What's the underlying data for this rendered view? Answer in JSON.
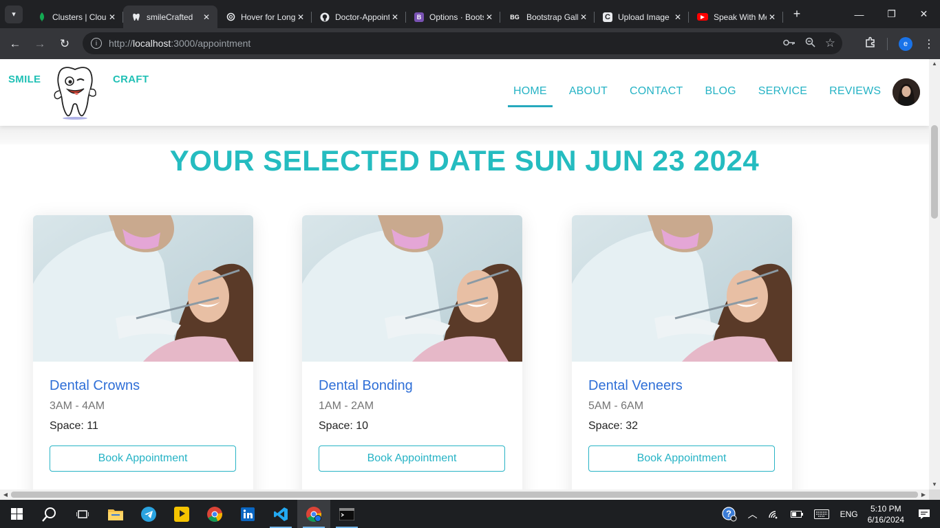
{
  "browser": {
    "tabs": [
      {
        "title": "Clusters | Cloud",
        "icon": "mongodb-leaf-icon",
        "color": "#13aa52"
      },
      {
        "title": "smileCrafted",
        "icon": "site-tooth-icon",
        "color": "#ffffff",
        "active": true
      },
      {
        "title": "Hover for Long",
        "icon": "openai-icon",
        "color": "#ffffff"
      },
      {
        "title": "Doctor-Appointment",
        "icon": "github-icon",
        "color": "#ffffff"
      },
      {
        "title": "Options · Bootstrap",
        "icon": "bootstrap-icon",
        "color": "#7952b3"
      },
      {
        "title": "Bootstrap Gallery",
        "icon": "bg-icon",
        "color": "#ffffff"
      },
      {
        "title": "Upload Image",
        "icon": "c-icon",
        "color": "#ffffff"
      },
      {
        "title": "Speak With Me",
        "icon": "youtube-icon",
        "color": "#ff0000"
      }
    ],
    "url_prefix": "http://",
    "url_host": "localhost",
    "url_rest": ":3000/appointment",
    "profile_letter": "e"
  },
  "site": {
    "logo_left": "SMILE",
    "logo_right": "CRAFT",
    "nav": [
      "HOME",
      "ABOUT",
      "CONTACT",
      "BLOG",
      "SERVICE",
      "REVIEWS"
    ],
    "nav_active": "HOME",
    "accent": "#26b3c5"
  },
  "page": {
    "heading": "YOUR SELECTED DATE SUN JUN 23 2024",
    "cards": [
      {
        "title": "Dental Crowns",
        "time": "3AM - 4AM",
        "space_label": "Space: 11",
        "button": "Book Appointment"
      },
      {
        "title": "Dental Bonding",
        "time": "1AM - 2AM",
        "space_label": "Space: 10",
        "button": "Book Appointment"
      },
      {
        "title": "Dental Veneers",
        "time": "5AM - 6AM",
        "space_label": "Space: 32",
        "button": "Book Appointment"
      }
    ]
  },
  "taskbar": {
    "language": "ENG",
    "time": "5:10 PM",
    "date": "6/16/2024"
  }
}
